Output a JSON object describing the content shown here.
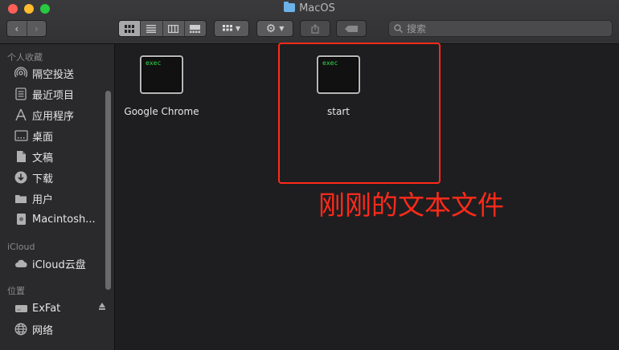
{
  "window": {
    "title": "MacOS"
  },
  "toolbar": {
    "back_icon": "chevron-left-icon",
    "forward_icon": "chevron-right-icon",
    "view_modes": [
      "icon-view",
      "list-view",
      "column-view",
      "gallery-view"
    ],
    "group_icon": "group-grid-icon",
    "action_icon": "gear-icon",
    "share_icon": "share-icon",
    "tag_icon": "tag-icon",
    "search_placeholder": "搜索"
  },
  "sidebar": {
    "favorites_header": "个人收藏",
    "favorites": [
      {
        "label": "隔空投送",
        "icon": "airdrop-icon"
      },
      {
        "label": "最近项目",
        "icon": "recents-icon"
      },
      {
        "label": "应用程序",
        "icon": "applications-icon"
      },
      {
        "label": "桌面",
        "icon": "desktop-icon"
      },
      {
        "label": "文稿",
        "icon": "documents-icon"
      },
      {
        "label": "下载",
        "icon": "downloads-icon"
      },
      {
        "label": "用户",
        "icon": "folder-icon"
      },
      {
        "label": "Macintosh...",
        "icon": "disk-icon"
      }
    ],
    "icloud_header": "iCloud",
    "icloud": [
      {
        "label": "iCloud云盘",
        "icon": "cloud-icon"
      }
    ],
    "locations_header": "位置",
    "locations": [
      {
        "label": "ExFat",
        "icon": "drive-icon"
      },
      {
        "label": "网络",
        "icon": "network-icon"
      }
    ]
  },
  "files": [
    {
      "name": "Google Chrome",
      "badge": "exec"
    },
    {
      "name": "start",
      "badge": "exec"
    }
  ],
  "annotation": {
    "text": "刚刚的文本文件",
    "color": "#ff2a1a"
  }
}
